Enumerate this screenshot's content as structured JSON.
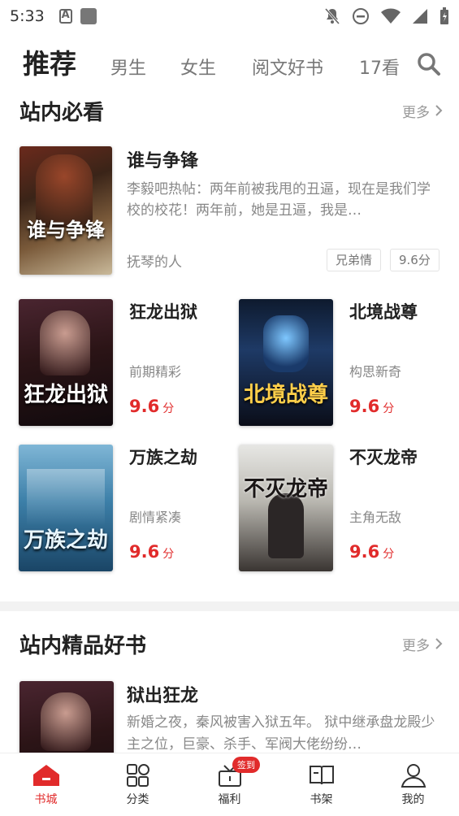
{
  "status_bar": {
    "time": "5:33"
  },
  "top_tabs": [
    {
      "label": "推荐",
      "active": true
    },
    {
      "label": "男生",
      "active": false
    },
    {
      "label": "女生",
      "active": false
    },
    {
      "label": "阅文好书",
      "active": false
    },
    {
      "label": "17看",
      "active": false
    }
  ],
  "section1": {
    "title": "站内必看",
    "more": "更多",
    "featured": {
      "title": "谁与争锋",
      "cover_text": "谁与争锋",
      "desc": "李毅吧热帖：两年前被我甩的丑逼，现在是我们学校的校花！两年前，她是丑逼，我是…",
      "author": "抚琴的人",
      "tags": [
        "兄弟情",
        "9.6分"
      ]
    },
    "books": [
      {
        "title": "狂龙出狱",
        "desc": "前期精彩",
        "score": "9.6",
        "unit": "分",
        "cover_text": "狂龙出狱"
      },
      {
        "title": "北境战尊",
        "desc": "构思新奇",
        "score": "9.6",
        "unit": "分",
        "cover_text": "北境战尊"
      },
      {
        "title": "万族之劫",
        "desc": "剧情紧凑",
        "score": "9.6",
        "unit": "分",
        "cover_text": "万族之劫"
      },
      {
        "title": "不灭龙帝",
        "desc": "主角无敌",
        "score": "9.6",
        "unit": "分",
        "cover_text": "不灭龙帝"
      }
    ]
  },
  "section2": {
    "title": "站内精品好书",
    "more": "更多",
    "book": {
      "title": "狱出狂龙",
      "desc": "新婚之夜，秦风被害入狱五年。 狱中继承盘龙殿少主之位，巨豪、杀手、军阀大佬纷纷…"
    }
  },
  "bottom_nav": [
    {
      "label": "书城",
      "icon": "home-icon",
      "active": true
    },
    {
      "label": "分类",
      "icon": "grid-icon",
      "active": false
    },
    {
      "label": "福利",
      "icon": "gift-icon",
      "active": false,
      "badge": "签到"
    },
    {
      "label": "书架",
      "icon": "book-icon",
      "active": false
    },
    {
      "label": "我的",
      "icon": "user-icon",
      "active": false
    }
  ],
  "colors": {
    "accent": "#e12b2b"
  }
}
